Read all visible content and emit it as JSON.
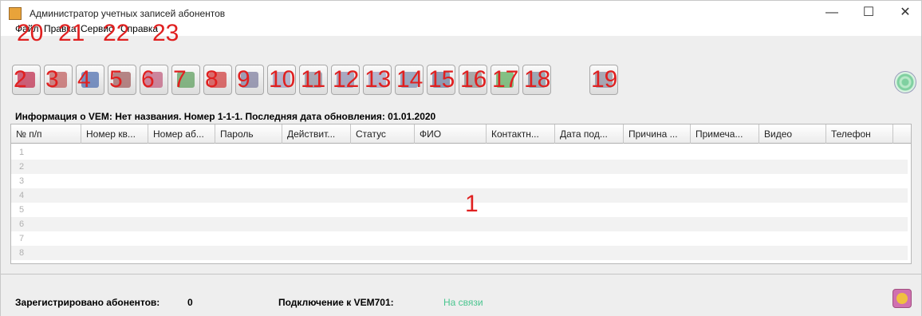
{
  "window": {
    "title": "Администратор учетных записей абонентов",
    "controls": {
      "minimize": "—",
      "maximize": "☐",
      "close": "✕"
    }
  },
  "menu": [
    "Файл",
    "Правка",
    "Сервис",
    "Справка"
  ],
  "menu_markers": [
    "20",
    "21",
    "22",
    "23"
  ],
  "toolbar": {
    "buttons": [
      {
        "num": "2",
        "icon": "user-add-icon",
        "color": "#c03050"
      },
      {
        "num": "3",
        "icon": "folder-open-icon",
        "color": "#c06060"
      },
      {
        "num": "4",
        "icon": "save-icon",
        "color": "#5070b0"
      },
      {
        "num": "5",
        "icon": "user-edit-icon",
        "color": "#a06060"
      },
      {
        "num": "6",
        "icon": "user-remove-icon",
        "color": "#c06080"
      },
      {
        "num": "7",
        "icon": "add-user-green-icon",
        "color": "#60a060"
      },
      {
        "num": "8",
        "icon": "delete-user-icon",
        "color": "#d04040"
      },
      {
        "num": "9",
        "icon": "settings-icon",
        "color": "#8080a0"
      },
      {
        "num": "10",
        "icon": "calendar-icon",
        "color": "#a0a0c0"
      },
      {
        "num": "11",
        "icon": "database-icon",
        "color": "#9090a0"
      },
      {
        "num": "12",
        "icon": "database-sync-icon",
        "color": "#9090b0"
      },
      {
        "num": "13",
        "icon": "phone-icon",
        "color": "#a0a0c0"
      },
      {
        "num": "14",
        "icon": "gear-icon",
        "color": "#8090b0"
      },
      {
        "num": "15",
        "icon": "sort-icon",
        "color": "#7080a0"
      },
      {
        "num": "16",
        "icon": "document-icon",
        "color": "#909090"
      },
      {
        "num": "17",
        "icon": "download-icon",
        "color": "#60b060"
      },
      {
        "num": "18",
        "icon": "monitor-icon",
        "color": "#8090a0"
      },
      {
        "num": "19",
        "icon": "display-icon",
        "color": "#9090a0"
      }
    ],
    "broadcast_icon": "signal-icon"
  },
  "info_line": "Информация о VEM: Нет названия. Номер 1-1-1. Последняя дата обновления: 01.01.2020",
  "table": {
    "columns": [
      "№ п/п",
      "Номер кв...",
      "Номер аб...",
      "Пароль",
      "Действит...",
      "Статус",
      "ФИО",
      "Контактн...",
      "Дата под...",
      "Причина ...",
      "Примеча...",
      "Видео",
      "Телефон"
    ],
    "rows": [
      "1",
      "2",
      "3",
      "4",
      "5",
      "6",
      "7",
      "8"
    ],
    "marker": "1"
  },
  "status": {
    "registered_label": "Зарегистрировано абонентов:",
    "registered_count": "0",
    "connection_label": "Подключение к VEM701:",
    "connection_value": "На связи",
    "connection_color": "#4ac58f"
  }
}
